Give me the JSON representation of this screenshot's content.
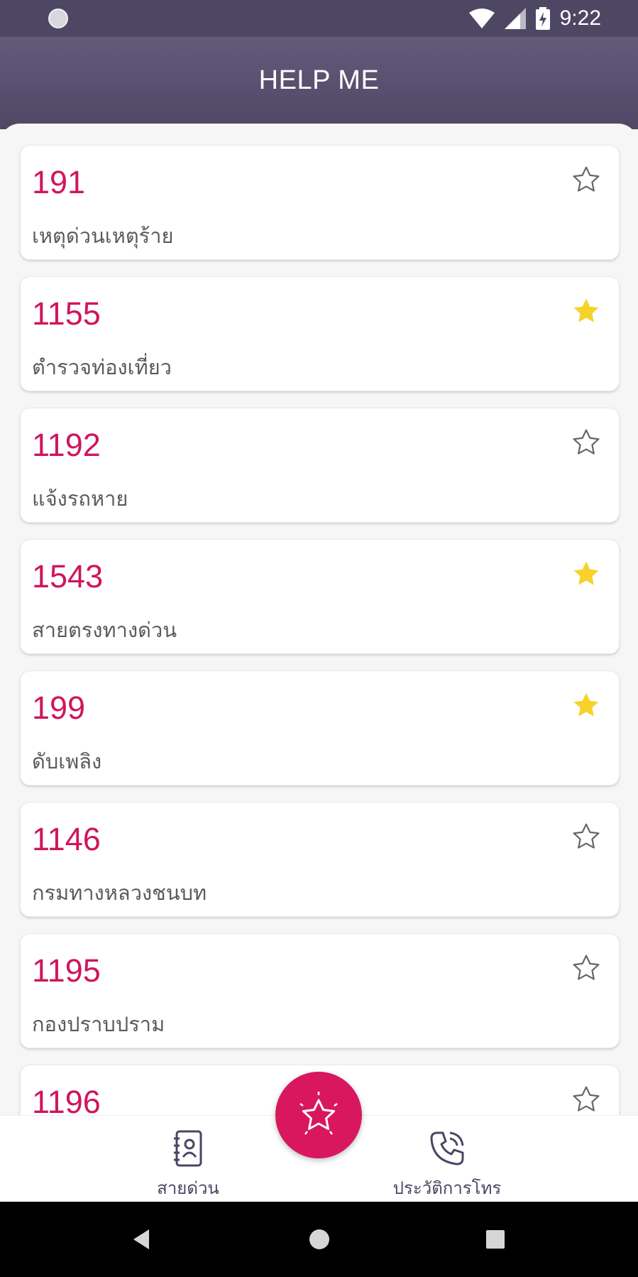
{
  "status": {
    "time": "9:22"
  },
  "app": {
    "title": "HELP ME"
  },
  "hotlines": [
    {
      "number": "191",
      "desc": "เหตุด่วนเหตุร้าย",
      "favorite": false
    },
    {
      "number": "1155",
      "desc": "ตำรวจท่องเที่ยว",
      "favorite": true
    },
    {
      "number": "1192",
      "desc": "แจ้งรถหาย",
      "favorite": false
    },
    {
      "number": "1543",
      "desc": "สายตรงทางด่วน",
      "favorite": true
    },
    {
      "number": "199",
      "desc": "ดับเพลิง",
      "favorite": true
    },
    {
      "number": "1146",
      "desc": "กรมทางหลวงชนบท",
      "favorite": false
    },
    {
      "number": "1195",
      "desc": "กองปราบปราม",
      "favorite": false
    },
    {
      "number": "1196",
      "desc": "",
      "favorite": false
    }
  ],
  "nav": {
    "hotline_label": "สายด่วน",
    "history_label": "ประวัติการโทร"
  },
  "colors": {
    "accent": "#d8175e",
    "header": "#5a5270",
    "star_filled": "#f6d22b"
  }
}
